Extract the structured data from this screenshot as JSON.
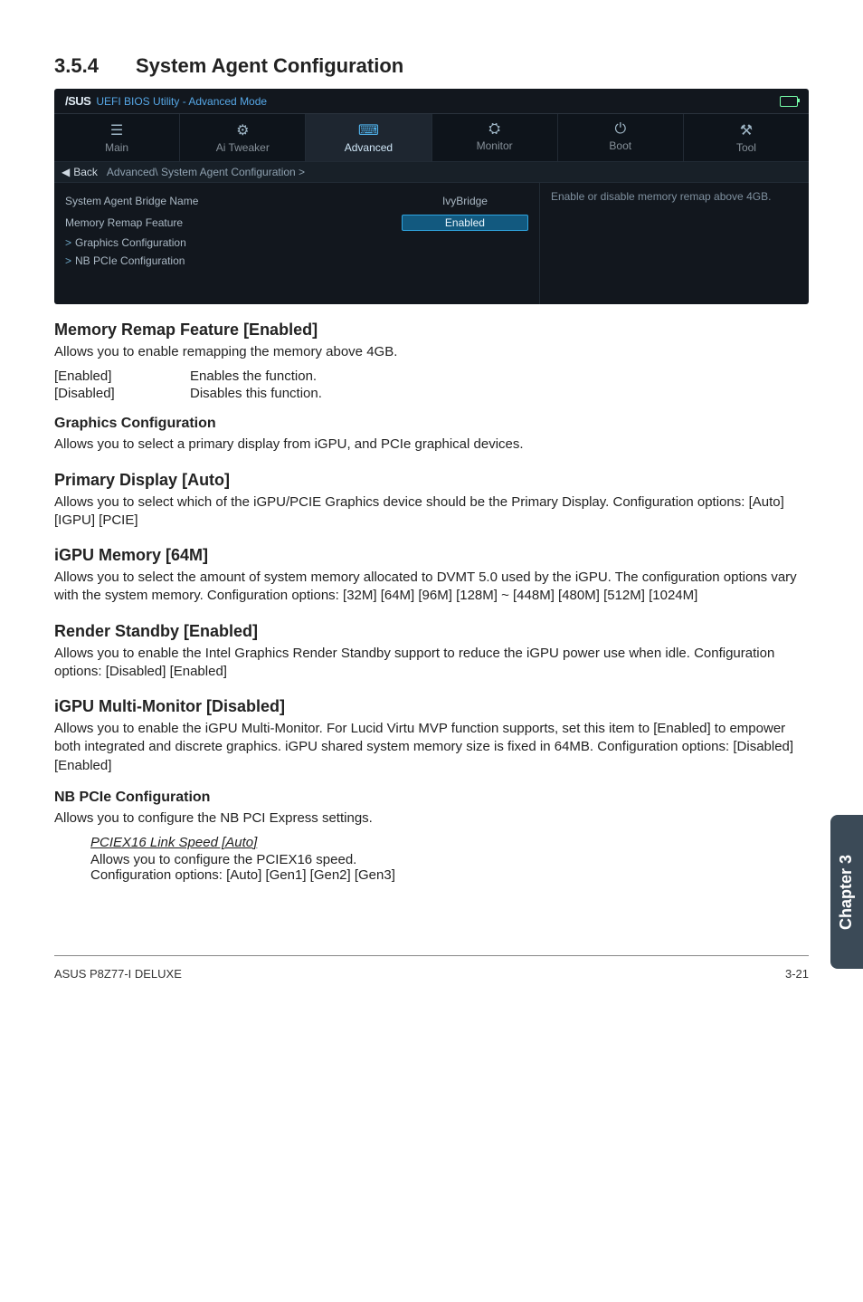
{
  "section": {
    "number": "3.5.4",
    "title": "System Agent Configuration"
  },
  "bios": {
    "top_title": "UEFI BIOS Utility - Advanced Mode",
    "logo": "/SUS",
    "tabs": [
      {
        "icon": "list-icon",
        "glyph": "☰",
        "label": "Main"
      },
      {
        "icon": "ai-tweaker-icon",
        "glyph": "⚙",
        "label": "Ai  Tweaker"
      },
      {
        "icon": "chip-icon",
        "glyph": "⌨",
        "label": "Advanced"
      },
      {
        "icon": "monitor-icon",
        "glyph": "⛭",
        "label": "Monitor"
      },
      {
        "icon": "power-icon",
        "glyph": "⏻",
        "label": "Boot"
      },
      {
        "icon": "tool-icon",
        "glyph": "⚒",
        "label": "Tool"
      }
    ],
    "active_tab_index": 2,
    "back_label": "Back",
    "breadcrumb": "Advanced\\ System Agent Configuration  >",
    "rows": [
      {
        "key": "System Agent Bridge Name",
        "val": "IvyBridge",
        "hl": false,
        "name": "row-bridge-name"
      },
      {
        "key": "Memory Remap Feature",
        "val": "Enabled",
        "hl": true,
        "name": "row-memory-remap"
      }
    ],
    "links": [
      {
        "label": "Graphics Configuration",
        "name": "link-graphics-config"
      },
      {
        "label": "NB PCIe Configuration",
        "name": "link-nb-pcie-config"
      }
    ],
    "help": "Enable or disable memory remap above 4GB."
  },
  "content": {
    "h1": "Memory Remap Feature [Enabled]",
    "p1": "Allows you to enable remapping the memory above 4GB.",
    "opts": [
      {
        "k": "[Enabled]",
        "v": "Enables the function."
      },
      {
        "k": "[Disabled]",
        "v": "Disables this function."
      }
    ],
    "h2": "Graphics Configuration",
    "p2": "Allows you to select a primary display from iGPU, and PCIe graphical devices.",
    "h3": "Primary Display [Auto]",
    "p3": "Allows you to select which of the iGPU/PCIE Graphics device should be the Primary Display. Configuration options: [Auto] [IGPU] [PCIE]",
    "h4": "iGPU Memory [64M]",
    "p4": "Allows you to select the amount of system memory allocated to DVMT 5.0 used by the iGPU. The configuration options vary with the system memory. Configuration options: [32M] [64M] [96M] [128M] ~ [448M] [480M] [512M] [1024M]",
    "h5": "Render Standby [Enabled]",
    "p5": "Allows you to enable the Intel Graphics Render Standby support to reduce the iGPU power use when idle. Configuration options: [Disabled] [Enabled]",
    "h6": "iGPU Multi-Monitor [Disabled]",
    "p6": "Allows you to enable the iGPU Multi-Monitor. For Lucid Virtu MVP function supports, set this item to [Enabled] to empower both integrated and discrete graphics. iGPU shared system memory size is fixed in 64MB. Configuration options: [Disabled] [Enabled]",
    "h7": "NB PCIe Configuration",
    "p7": "Allows you to configure the NB PCI Express settings.",
    "sub_title": "PCIEX16 Link Speed [Auto]",
    "sub_l1": "Allows you to configure the PCIEX16 speed.",
    "sub_l2": "Configuration options: [Auto] [Gen1] [Gen2] [Gen3]"
  },
  "side_tab": "Chapter 3",
  "footer": {
    "left": "ASUS P8Z77-I DELUXE",
    "right": "3-21"
  }
}
